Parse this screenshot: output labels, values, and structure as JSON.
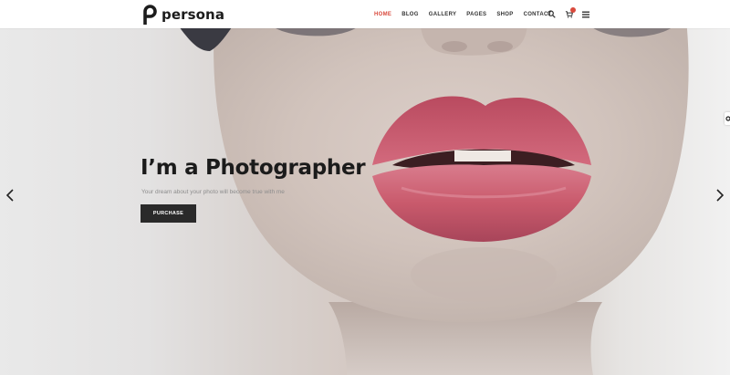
{
  "brand": {
    "name": "persona",
    "icon": "persona-logo-icon"
  },
  "nav": {
    "items": [
      {
        "label": "HOME",
        "active": true
      },
      {
        "label": "BLOG",
        "active": false
      },
      {
        "label": "GALLERY",
        "active": false
      },
      {
        "label": "PAGES",
        "active": false
      },
      {
        "label": "SHOP",
        "active": false
      },
      {
        "label": "CONTACT",
        "active": false
      }
    ],
    "tools": [
      "search-icon",
      "cart-icon",
      "menu-icon"
    ]
  },
  "hero": {
    "title": "I’m a Photographer",
    "subtitle": "Your dream about your photo will become true with me",
    "button_label": "PURCHASE"
  },
  "slider": {
    "prev_icon": "chevron-left-icon",
    "next_icon": "chevron-right-icon"
  },
  "colors": {
    "accent": "#d94a3d",
    "button": "#2a2a2a",
    "title": "#1b1b1b",
    "lips": "#c95a6c"
  }
}
